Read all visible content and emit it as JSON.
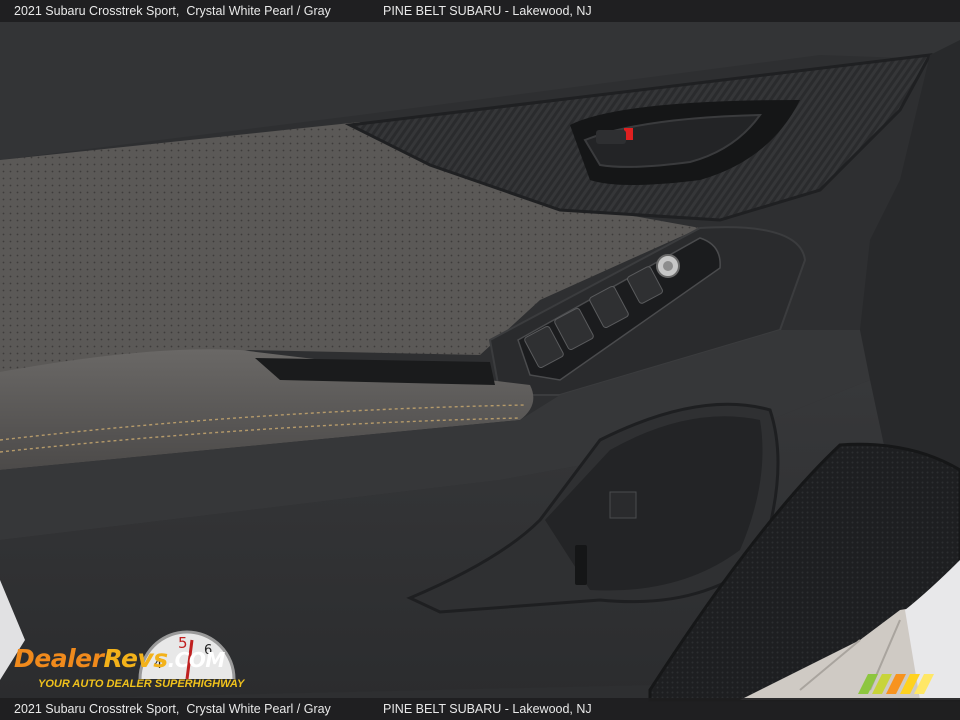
{
  "header": {
    "vehicle": "2021 Subaru Crosstrek Sport,",
    "colors": "Crystal White Pearl / Gray",
    "dealer": "PINE BELT SUBARU - Lakewood, NJ"
  },
  "footer": {
    "vehicle": "2021 Subaru Crosstrek Sport,",
    "colors": "Crystal White Pearl / Gray",
    "dealer": "PINE BELT SUBARU - Lakewood, NJ"
  },
  "watermark": {
    "brand_part1": "Dealer",
    "brand_part2": "Revs",
    "brand_part3": ".COM",
    "tagline": "YOUR AUTO DEALER SUPERHIGHWAY",
    "gauge_digits": [
      "4",
      "5",
      "6"
    ]
  },
  "colors": {
    "door_dark": "#2c2d2f",
    "door_panel": "#4a4a4c",
    "leather_gray": "#5e5b59",
    "stitching": "#b59a6a",
    "floor": "#cfcac4",
    "red_indicator": "#e02020"
  }
}
